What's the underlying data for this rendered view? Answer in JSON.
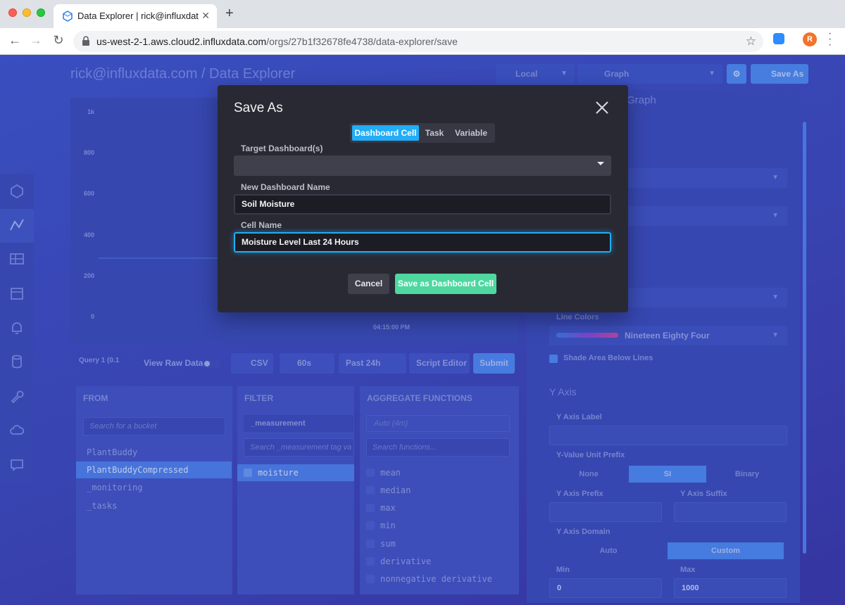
{
  "browser": {
    "tab_title": "Data Explorer | rick@influxdata.com",
    "url_host": "us-west-2-1.aws.cloud2.influxdata.com",
    "url_path": "/orgs/27b1f32678fe4738/data-explorer/save",
    "avatar_letter": "R"
  },
  "header": {
    "title": "rick@influxdata.com / Data Explorer",
    "timezone": "Local",
    "view_type": "Graph",
    "save_as": "Save As"
  },
  "chart": {
    "y_ticks": [
      "1k",
      "800",
      "600",
      "400",
      "200",
      "0"
    ],
    "x_tick": "04:15:00 PM"
  },
  "query_bar": {
    "query_tab": "Query 1",
    "query_tab_suffix": "(0.1",
    "view_raw": "View Raw Data",
    "csv": "CSV",
    "refresh": "60s",
    "time_range": "Past 24h",
    "script_editor": "Script Editor",
    "submit": "Submit"
  },
  "builder": {
    "from": {
      "heading": "FROM",
      "search_placeholder": "Search for a bucket",
      "buckets": [
        "PlantBuddy",
        "PlantBuddyCompressed",
        "_monitoring",
        "_tasks"
      ],
      "selected": "PlantBuddyCompressed"
    },
    "filter": {
      "heading": "FILTER",
      "key": "_measurement",
      "search_placeholder": "Search _measurement tag va",
      "values": [
        "moisture"
      ]
    },
    "aggregate": {
      "heading": "AGGREGATE FUNCTIONS",
      "window": "Auto (4m)",
      "search_placeholder": "Search functions...",
      "functions": [
        "mean",
        "median",
        "max",
        "min",
        "sum",
        "derivative",
        "nonnegative derivative"
      ]
    }
  },
  "options": {
    "title": "Graph",
    "line_colors_label": "Line Colors",
    "line_colors_value": "Nineteen Eighty Four",
    "shade_label": "Shade Area Below Lines",
    "y_axis_heading": "Y Axis",
    "y_axis_label": "Y Axis Label",
    "unit_prefix_label": "Y-Value Unit Prefix",
    "unit_prefix_options": [
      "None",
      "SI",
      "Binary"
    ],
    "unit_prefix_selected": "SI",
    "prefix_label": "Y Axis Prefix",
    "suffix_label": "Y Axis Suffix",
    "domain_label": "Y Axis Domain",
    "domain_options": [
      "Auto",
      "Custom"
    ],
    "domain_selected": "Custom",
    "min_label": "Min",
    "max_label": "Max",
    "min_value": "0",
    "max_value": "1000"
  },
  "modal": {
    "title": "Save As",
    "tabs": [
      "Dashboard Cell",
      "Task",
      "Variable"
    ],
    "active_tab": "Dashboard Cell",
    "target_label": "Target Dashboard(s)",
    "new_name_label": "New Dashboard Name",
    "new_name_value": "Soil Moisture",
    "cell_name_label": "Cell Name",
    "cell_name_value": "Moisture Level Last 24 Hours",
    "cancel": "Cancel",
    "save": "Save as Dashboard Cell"
  },
  "colors": {
    "modal_bg": "#292933",
    "active_tab": "#22adf6",
    "save_button": "#4ed8a0",
    "app_bg": "#3d4bb5"
  }
}
